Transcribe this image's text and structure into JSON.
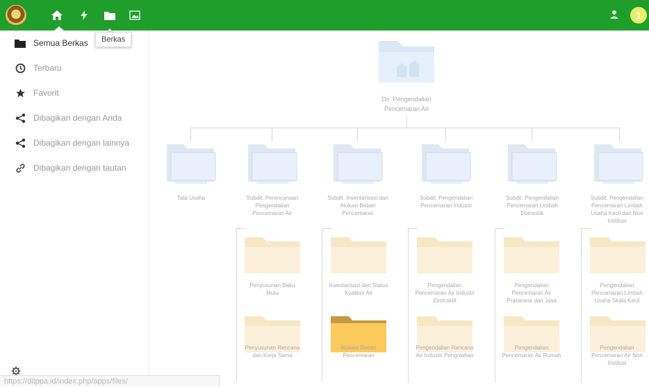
{
  "topbar": {
    "nav": [
      {
        "name": "files",
        "icon": "home-icon"
      },
      {
        "name": "activity",
        "icon": "lightning-icon"
      },
      {
        "name": "files-folder",
        "icon": "folder-icon"
      },
      {
        "name": "gallery",
        "icon": "image-icon"
      }
    ],
    "tooltip": "Berkas",
    "avatar_initial": "1",
    "colors": {
      "bar": "#1f9e2c",
      "avatar": "#e7ee6e"
    }
  },
  "sidebar": {
    "items": [
      {
        "label": "Semua Berkas",
        "icon": "folder-icon",
        "active": true
      },
      {
        "label": "Terbaru",
        "icon": "clock-icon",
        "active": false
      },
      {
        "label": "Favorit",
        "icon": "star-icon",
        "active": false
      },
      {
        "label": "Dibagikan dengan Anda",
        "icon": "share-icon",
        "active": false
      },
      {
        "label": "Dibagikan dengan lainnya",
        "icon": "share-icon",
        "active": false
      },
      {
        "label": "Dibagikan dengan tautan",
        "icon": "link-icon",
        "active": false
      }
    ],
    "status_url": "https://ditppa.id/index.php/apps/files/"
  },
  "orgchart": {
    "root": {
      "label_line1": "Dir. Pengendalian",
      "label_line2": "Pencemaran Air"
    },
    "level1": [
      {
        "label": "Tata Usaha"
      },
      {
        "label": "Subdit. Perencanaan Pengendalian Pencemaran Air"
      },
      {
        "label": "Subdit. Inventarisasi dan Alokasi Beban Pencemaran"
      },
      {
        "label": "Subdit. Pengendalian Pencemaran Industri"
      },
      {
        "label": "Subdit. Pengendalian Pencemaran Limbah Domestik"
      },
      {
        "label": "Subdit. Pengendalian Pencemaran Limbah Usaha Kecil dan Non Institusi"
      }
    ],
    "level2_row1": [
      {
        "label": "Penyusunan Baku Mutu"
      },
      {
        "label": "Inventarisasi dan Status Kualitas Air"
      },
      {
        "label": "Pengendalian Pencemaran Air Industri Ekstraktif"
      },
      {
        "label": "Pengendalian Pencemaran Air Prasarana dan Jasa"
      },
      {
        "label": "Pengendalian Pencemaran Limbah Usaha Skala Kecil"
      }
    ],
    "level2_row2": [
      {
        "label": "Penyusunan Rencana dan Kerja Sama"
      },
      {
        "label": "Alokasi Beban Pencemaran"
      },
      {
        "label": "Pengendalian Rencana Air Industri Pengolahan"
      },
      {
        "label": "Pengendalian Pencemaran Air Rumah"
      },
      {
        "label": "Pengendalian Pencemaran Air Non Institusi"
      }
    ]
  }
}
